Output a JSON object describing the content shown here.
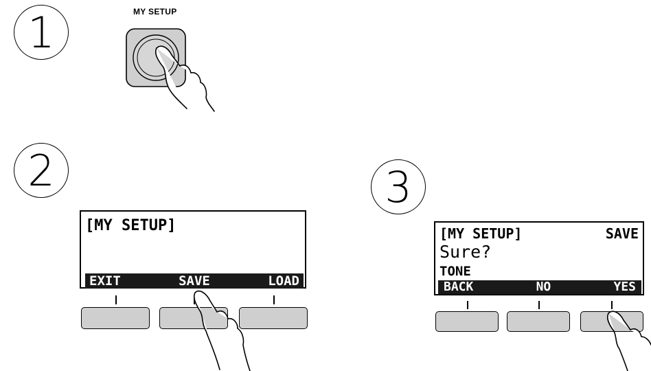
{
  "step1": {
    "number": "1",
    "caption": "MY SETUP"
  },
  "step2": {
    "number": "2",
    "display_title": "[MY SETUP]",
    "soft_keys": [
      "EXIT",
      "SAVE",
      "LOAD"
    ]
  },
  "step3": {
    "number": "3",
    "display_title": "[MY SETUP]",
    "display_mode": "SAVE",
    "display_prompt": "Sure?",
    "display_item": "TONE",
    "soft_keys": [
      "BACK",
      "NO",
      "YES"
    ]
  },
  "icons": [
    "hand-pointer-icon"
  ],
  "colors": {
    "button_fill": "#cfcfcf",
    "lcd_bar": "#1a1a1a"
  }
}
